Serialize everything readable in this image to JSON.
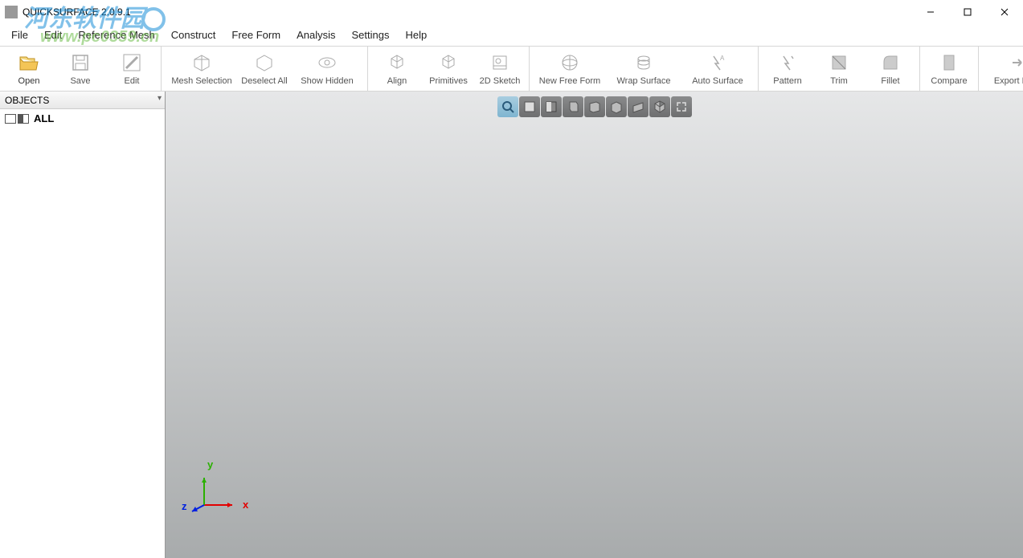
{
  "window": {
    "title": "QUICKSURFACE 2.0.9.1"
  },
  "watermark": {
    "text1": "河东软件园",
    "text2": "www.pc0359.cn"
  },
  "menubar": {
    "items": [
      "File",
      "Edit",
      "Reference Mesh",
      "Construct",
      "Free Form",
      "Analysis",
      "Settings",
      "Help"
    ]
  },
  "toolbar": {
    "groups": [
      {
        "buttons": [
          {
            "name": "open",
            "label": "Open",
            "active": true
          },
          {
            "name": "save",
            "label": "Save"
          },
          {
            "name": "edit",
            "label": "Edit"
          }
        ]
      },
      {
        "buttons": [
          {
            "name": "mesh-selection",
            "label": "Mesh Selection",
            "wide": true
          },
          {
            "name": "deselect-all",
            "label": "Deselect All"
          },
          {
            "name": "show-hidden",
            "label": "Show Hidden",
            "wide": true
          }
        ]
      },
      {
        "buttons": [
          {
            "name": "align",
            "label": "Align"
          },
          {
            "name": "primitives",
            "label": "Primitives"
          },
          {
            "name": "2d-sketch",
            "label": "2D Sketch"
          }
        ]
      },
      {
        "buttons": [
          {
            "name": "new-free-form",
            "label": "New Free Form",
            "wide": true
          },
          {
            "name": "wrap-surface",
            "label": "Wrap Surface",
            "wide": true
          },
          {
            "name": "auto-surface",
            "label": "Auto Surface",
            "wide": true
          }
        ]
      },
      {
        "buttons": [
          {
            "name": "pattern",
            "label": "Pattern"
          },
          {
            "name": "trim",
            "label": "Trim"
          },
          {
            "name": "fillet",
            "label": "Fillet"
          }
        ]
      },
      {
        "buttons": [
          {
            "name": "compare",
            "label": "Compare"
          }
        ]
      },
      {
        "buttons": [
          {
            "name": "export-model",
            "label": "Export Mode",
            "wide": true
          }
        ]
      }
    ]
  },
  "sidebar": {
    "header": "OBJECTS",
    "root": "ALL"
  },
  "viewport": {
    "viewButtons": [
      "zoom-fit",
      "front",
      "back",
      "left",
      "right",
      "top",
      "bottom",
      "iso",
      "fullscreen"
    ],
    "axis": {
      "x": "x",
      "y": "y",
      "z": "z"
    }
  }
}
